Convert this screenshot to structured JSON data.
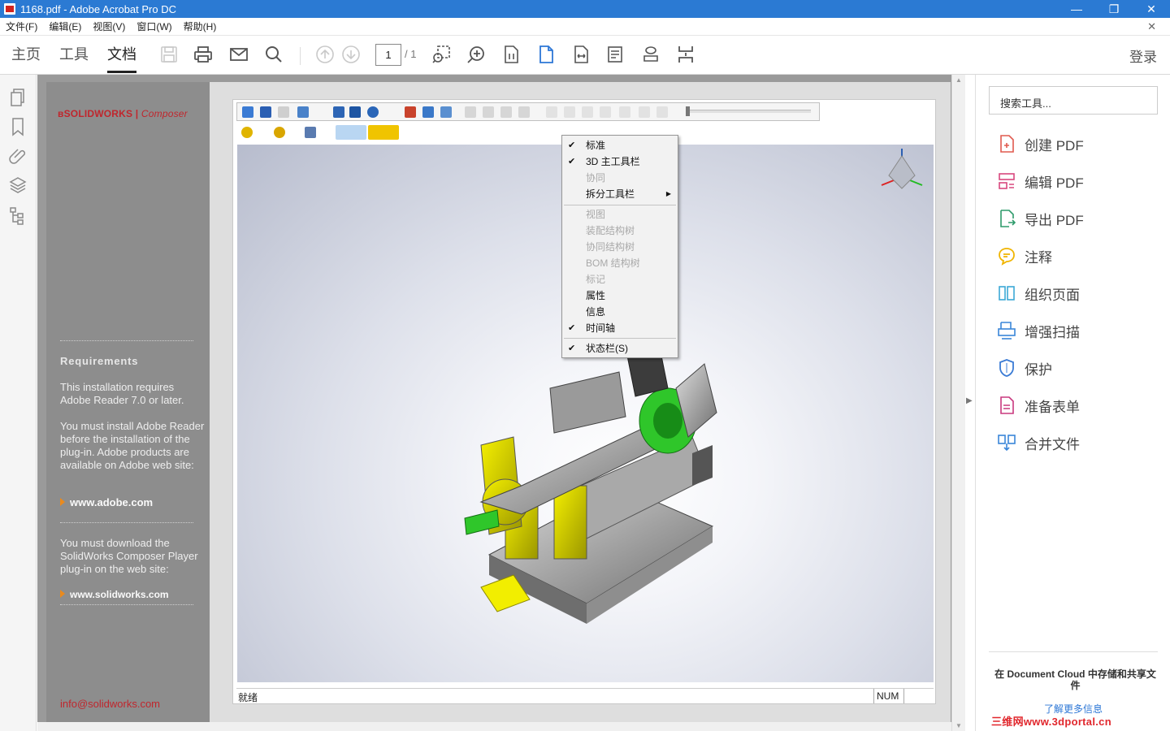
{
  "window": {
    "title": "1168.pdf - Adobe Acrobat Pro DC"
  },
  "menu": [
    "文件(F)",
    "编辑(E)",
    "视图(V)",
    "窗口(W)",
    "帮助(H)"
  ],
  "toolbar": {
    "tabs": [
      "主页",
      "工具",
      "文档"
    ],
    "active_tab": "文档",
    "page_current": "1",
    "page_total": "/ 1",
    "login": "登录"
  },
  "sidebar": {
    "logo_brand": "SOLIDWORKS",
    "logo_product": "Composer",
    "requirements_heading": "Requirements",
    "req_text": "This installation requires Adobe Reader 7.0 or later.",
    "install_text": "You must install Adobe Reader before the installation of the plug-in. Adobe products are available on Adobe web site:",
    "adobe_link": "www.adobe.com",
    "download_text": "You must download the SolidWorks Composer Player plug-in on the web site:",
    "sw_link": "www.solidworks.com",
    "email": "info@solidworks.com"
  },
  "viewer": {
    "status_text": "就绪",
    "num_indicator": "NUM"
  },
  "context_menu": [
    {
      "label": "标准",
      "checked": true,
      "disabled": false
    },
    {
      "label": "3D 主工具栏",
      "checked": true,
      "disabled": false
    },
    {
      "label": "协同",
      "checked": false,
      "disabled": true
    },
    {
      "label": "拆分工具栏",
      "checked": false,
      "disabled": false,
      "submenu": true
    },
    {
      "label": "视图",
      "checked": false,
      "disabled": true
    },
    {
      "label": "装配结构树",
      "checked": false,
      "disabled": true
    },
    {
      "label": "协同结构树",
      "checked": false,
      "disabled": true
    },
    {
      "label": "BOM 结构树",
      "checked": false,
      "disabled": true
    },
    {
      "label": "标记",
      "checked": false,
      "disabled": true
    },
    {
      "label": "属性",
      "checked": false,
      "disabled": false
    },
    {
      "label": "信息",
      "checked": false,
      "disabled": false
    },
    {
      "label": "时间轴",
      "checked": true,
      "disabled": false
    },
    {
      "label": "状态栏(S)",
      "checked": true,
      "disabled": false
    }
  ],
  "right_panel": {
    "search_placeholder": "搜索工具...",
    "tools": [
      {
        "label": "创建 PDF",
        "icon": "create-pdf-icon",
        "color": "#e05a4f"
      },
      {
        "label": "编辑 PDF",
        "icon": "edit-pdf-icon",
        "color": "#d9487e"
      },
      {
        "label": "导出 PDF",
        "icon": "export-pdf-icon",
        "color": "#2e9b6b"
      },
      {
        "label": "注释",
        "icon": "comment-icon",
        "color": "#f0b400"
      },
      {
        "label": "组织页面",
        "icon": "organize-pages-icon",
        "color": "#3ca8d6"
      },
      {
        "label": "增强扫描",
        "icon": "enhance-scan-icon",
        "color": "#3a86d9"
      },
      {
        "label": "保护",
        "icon": "protect-icon",
        "color": "#3a7bd5"
      },
      {
        "label": "准备表单",
        "icon": "prepare-form-icon",
        "color": "#c9397f"
      },
      {
        "label": "合并文件",
        "icon": "combine-files-icon",
        "color": "#3a86d9"
      }
    ],
    "cloud_text": "在 Document Cloud 中存储和共享文件",
    "learn_more": "了解更多信息"
  },
  "watermark": "三维网www.3dportal.cn"
}
